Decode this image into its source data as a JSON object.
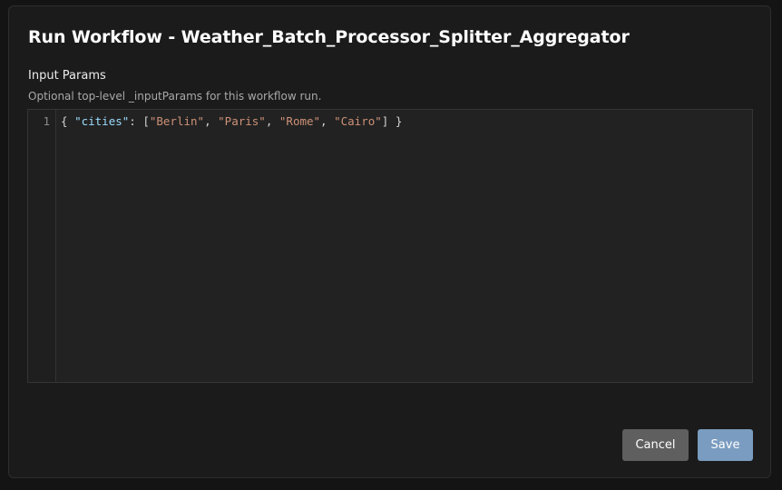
{
  "dialog": {
    "title": "Run Workflow - Weather_Batch_Processor_Splitter_Aggregator",
    "input_params": {
      "label": "Input Params",
      "help": "Optional top-level _inputParams for this workflow run."
    },
    "editor": {
      "line_numbers": [
        "1"
      ],
      "code": {
        "open_brace": "{ ",
        "key": "\"cities\"",
        "colon": ": [",
        "values": [
          "\"Berlin\"",
          "\"Paris\"",
          "\"Rome\"",
          "\"Cairo\""
        ],
        "separator": ", ",
        "close": "] }"
      }
    },
    "buttons": {
      "cancel_label": "Cancel",
      "save_label": "Save"
    }
  },
  "colors": {
    "background": "#141414",
    "dialog": "#1b1b1b",
    "editor_bg": "#222222",
    "json_key": "#9cdcfe",
    "json_string": "#ce9178",
    "cancel_button": "#5f5f5f",
    "save_button": "#7a9cc0"
  }
}
